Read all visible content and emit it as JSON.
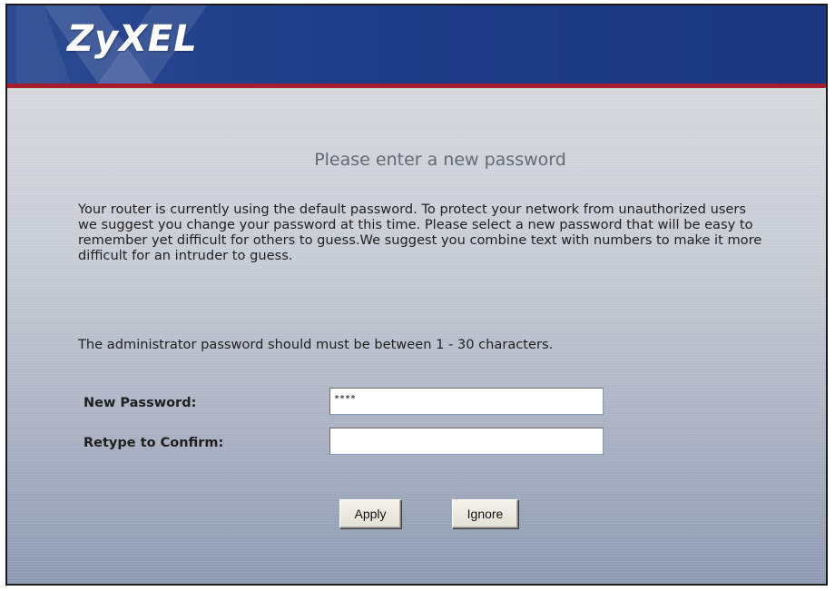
{
  "header": {
    "logo_text": "ZyXEL",
    "bg_color": "#1f3c88",
    "accent_line_color": "#a51c2a"
  },
  "main": {
    "title": "Please enter a new password",
    "description": "Your router is currently using the default password. To protect your network from unauthorized users we suggest you change your password at this time. Please select a new password that will be easy to remember yet difficult for others to guess.We suggest you combine text with numbers to make it more difficult for an intruder to guess.",
    "requirement": "The administrator password should must be between 1 - 30 characters."
  },
  "form": {
    "new_password": {
      "label": "New Password:",
      "value": "****"
    },
    "confirm_password": {
      "label": "Retype to Confirm:",
      "value": ""
    }
  },
  "buttons": {
    "apply_label": "Apply",
    "ignore_label": "Ignore"
  }
}
